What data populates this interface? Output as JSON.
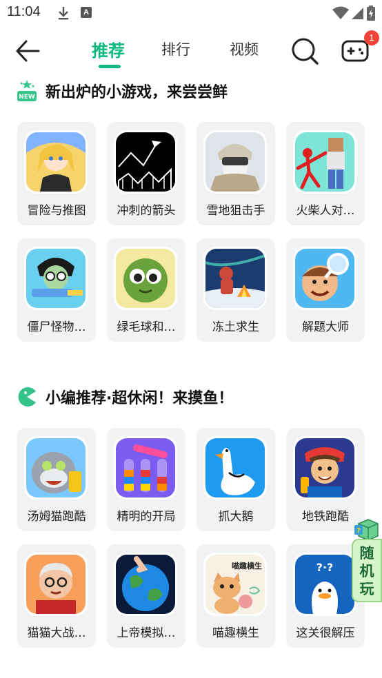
{
  "status_bar": {
    "time": "11:04",
    "badge_letter": "A"
  },
  "nav": {
    "tabs": [
      "推荐",
      "排行",
      "视频"
    ],
    "active_tab": 0,
    "notification_count": "1"
  },
  "sections": [
    {
      "title": "新出炉的小游戏，来尝尝鲜",
      "games": [
        "冒险与推图",
        "冲刺的箭头",
        "雪地狙击手",
        "火柴人对…",
        "僵尸怪物…",
        "绿毛球和…",
        "冻土求生",
        "解题大师"
      ]
    },
    {
      "title": "小编推荐·超休闲！来摸鱼！",
      "games": [
        "汤姆猫跑酷",
        "精明的开局",
        "抓大鹅",
        "地铁跑酷",
        "猫猫大战…",
        "上帝模拟…",
        "喵趣横生",
        "这关很解压"
      ]
    }
  ],
  "floating": {
    "random_label": "随机玩"
  },
  "icon_text": {
    "meow": "喵趣横生",
    "duck_q": "?·?"
  },
  "colors": {
    "accent": "#10b981",
    "badge": "#f04438"
  }
}
